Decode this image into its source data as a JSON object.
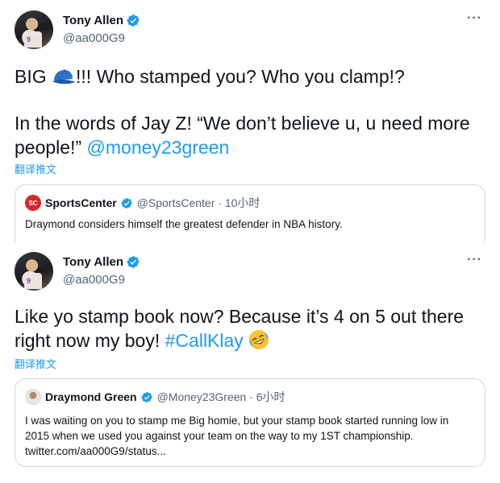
{
  "tweets": [
    {
      "author": {
        "name": "Tony Allen",
        "handle": "@aa000G9",
        "avatar_icon": "player-avatar-icon",
        "jersey_number": "9"
      },
      "more_label": "···",
      "text": {
        "line1_before_icon": "BIG ",
        "line1_icon": "blue-cap-icon",
        "line1_after_icon": "!!! Who stamped you? Who you clamp!?",
        "para2_text": "In the words of Jay Z! “We don’t believe u, u need more people!” ",
        "para2_mention": "@money23green"
      },
      "translate_label": "翻译推文",
      "quote": {
        "avatar_icon": "sportscenter-logo-icon",
        "avatar_text": "SC",
        "name": "SportsCenter",
        "handle": "@SportsCenter · 10小时",
        "body": "Draymond considers himself the greatest defender in NBA history."
      }
    },
    {
      "author": {
        "name": "Tony Allen",
        "handle": "@aa000G9",
        "avatar_icon": "player-avatar-icon",
        "jersey_number": "9"
      },
      "more_label": "···",
      "text": {
        "body_text": "Like yo stamp book now? Because it’s 4 on 5 out there right now my boy! ",
        "hashtag": "#CallKlay",
        "emoji_icon": "rolling-laughing-emoji-icon"
      },
      "translate_label": "翻译推文",
      "quote": {
        "avatar_icon": "draymond-avatar-icon",
        "name": "Draymond Green",
        "handle": "@Money23Green · 6小时",
        "body": "I was waiting on you to stamp me Big homie, but your stamp book started running low in 2015 when we used you against your team on the way to my 1ST championship. twitter.com/aa000G9/status..."
      }
    }
  ],
  "colors": {
    "link": "#1d9bf0",
    "verified": "#1d9bf0",
    "muted_text": "#536471",
    "border": "#cfd9de",
    "sportscenter_red": "#d8262c"
  }
}
